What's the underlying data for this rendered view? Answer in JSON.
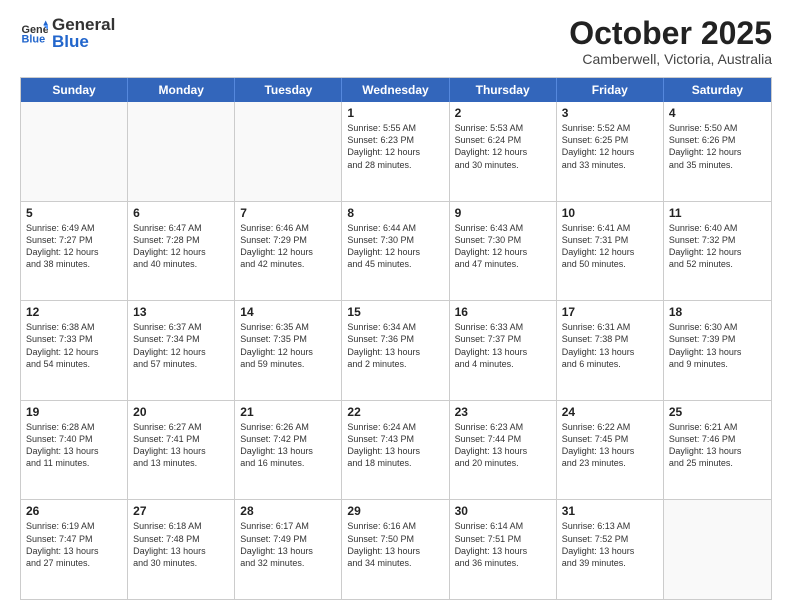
{
  "header": {
    "logo_general": "General",
    "logo_blue": "Blue",
    "month": "October 2025",
    "location": "Camberwell, Victoria, Australia"
  },
  "weekdays": [
    "Sunday",
    "Monday",
    "Tuesday",
    "Wednesday",
    "Thursday",
    "Friday",
    "Saturday"
  ],
  "rows": [
    [
      {
        "day": "",
        "info": "",
        "empty": true
      },
      {
        "day": "",
        "info": "",
        "empty": true
      },
      {
        "day": "",
        "info": "",
        "empty": true
      },
      {
        "day": "1",
        "info": "Sunrise: 5:55 AM\nSunset: 6:23 PM\nDaylight: 12 hours\nand 28 minutes.",
        "empty": false
      },
      {
        "day": "2",
        "info": "Sunrise: 5:53 AM\nSunset: 6:24 PM\nDaylight: 12 hours\nand 30 minutes.",
        "empty": false
      },
      {
        "day": "3",
        "info": "Sunrise: 5:52 AM\nSunset: 6:25 PM\nDaylight: 12 hours\nand 33 minutes.",
        "empty": false
      },
      {
        "day": "4",
        "info": "Sunrise: 5:50 AM\nSunset: 6:26 PM\nDaylight: 12 hours\nand 35 minutes.",
        "empty": false
      }
    ],
    [
      {
        "day": "5",
        "info": "Sunrise: 6:49 AM\nSunset: 7:27 PM\nDaylight: 12 hours\nand 38 minutes.",
        "empty": false
      },
      {
        "day": "6",
        "info": "Sunrise: 6:47 AM\nSunset: 7:28 PM\nDaylight: 12 hours\nand 40 minutes.",
        "empty": false
      },
      {
        "day": "7",
        "info": "Sunrise: 6:46 AM\nSunset: 7:29 PM\nDaylight: 12 hours\nand 42 minutes.",
        "empty": false
      },
      {
        "day": "8",
        "info": "Sunrise: 6:44 AM\nSunset: 7:30 PM\nDaylight: 12 hours\nand 45 minutes.",
        "empty": false
      },
      {
        "day": "9",
        "info": "Sunrise: 6:43 AM\nSunset: 7:30 PM\nDaylight: 12 hours\nand 47 minutes.",
        "empty": false
      },
      {
        "day": "10",
        "info": "Sunrise: 6:41 AM\nSunset: 7:31 PM\nDaylight: 12 hours\nand 50 minutes.",
        "empty": false
      },
      {
        "day": "11",
        "info": "Sunrise: 6:40 AM\nSunset: 7:32 PM\nDaylight: 12 hours\nand 52 minutes.",
        "empty": false
      }
    ],
    [
      {
        "day": "12",
        "info": "Sunrise: 6:38 AM\nSunset: 7:33 PM\nDaylight: 12 hours\nand 54 minutes.",
        "empty": false
      },
      {
        "day": "13",
        "info": "Sunrise: 6:37 AM\nSunset: 7:34 PM\nDaylight: 12 hours\nand 57 minutes.",
        "empty": false
      },
      {
        "day": "14",
        "info": "Sunrise: 6:35 AM\nSunset: 7:35 PM\nDaylight: 12 hours\nand 59 minutes.",
        "empty": false
      },
      {
        "day": "15",
        "info": "Sunrise: 6:34 AM\nSunset: 7:36 PM\nDaylight: 13 hours\nand 2 minutes.",
        "empty": false
      },
      {
        "day": "16",
        "info": "Sunrise: 6:33 AM\nSunset: 7:37 PM\nDaylight: 13 hours\nand 4 minutes.",
        "empty": false
      },
      {
        "day": "17",
        "info": "Sunrise: 6:31 AM\nSunset: 7:38 PM\nDaylight: 13 hours\nand 6 minutes.",
        "empty": false
      },
      {
        "day": "18",
        "info": "Sunrise: 6:30 AM\nSunset: 7:39 PM\nDaylight: 13 hours\nand 9 minutes.",
        "empty": false
      }
    ],
    [
      {
        "day": "19",
        "info": "Sunrise: 6:28 AM\nSunset: 7:40 PM\nDaylight: 13 hours\nand 11 minutes.",
        "empty": false
      },
      {
        "day": "20",
        "info": "Sunrise: 6:27 AM\nSunset: 7:41 PM\nDaylight: 13 hours\nand 13 minutes.",
        "empty": false
      },
      {
        "day": "21",
        "info": "Sunrise: 6:26 AM\nSunset: 7:42 PM\nDaylight: 13 hours\nand 16 minutes.",
        "empty": false
      },
      {
        "day": "22",
        "info": "Sunrise: 6:24 AM\nSunset: 7:43 PM\nDaylight: 13 hours\nand 18 minutes.",
        "empty": false
      },
      {
        "day": "23",
        "info": "Sunrise: 6:23 AM\nSunset: 7:44 PM\nDaylight: 13 hours\nand 20 minutes.",
        "empty": false
      },
      {
        "day": "24",
        "info": "Sunrise: 6:22 AM\nSunset: 7:45 PM\nDaylight: 13 hours\nand 23 minutes.",
        "empty": false
      },
      {
        "day": "25",
        "info": "Sunrise: 6:21 AM\nSunset: 7:46 PM\nDaylight: 13 hours\nand 25 minutes.",
        "empty": false
      }
    ],
    [
      {
        "day": "26",
        "info": "Sunrise: 6:19 AM\nSunset: 7:47 PM\nDaylight: 13 hours\nand 27 minutes.",
        "empty": false
      },
      {
        "day": "27",
        "info": "Sunrise: 6:18 AM\nSunset: 7:48 PM\nDaylight: 13 hours\nand 30 minutes.",
        "empty": false
      },
      {
        "day": "28",
        "info": "Sunrise: 6:17 AM\nSunset: 7:49 PM\nDaylight: 13 hours\nand 32 minutes.",
        "empty": false
      },
      {
        "day": "29",
        "info": "Sunrise: 6:16 AM\nSunset: 7:50 PM\nDaylight: 13 hours\nand 34 minutes.",
        "empty": false
      },
      {
        "day": "30",
        "info": "Sunrise: 6:14 AM\nSunset: 7:51 PM\nDaylight: 13 hours\nand 36 minutes.",
        "empty": false
      },
      {
        "day": "31",
        "info": "Sunrise: 6:13 AM\nSunset: 7:52 PM\nDaylight: 13 hours\nand 39 minutes.",
        "empty": false
      },
      {
        "day": "",
        "info": "",
        "empty": true
      }
    ]
  ]
}
